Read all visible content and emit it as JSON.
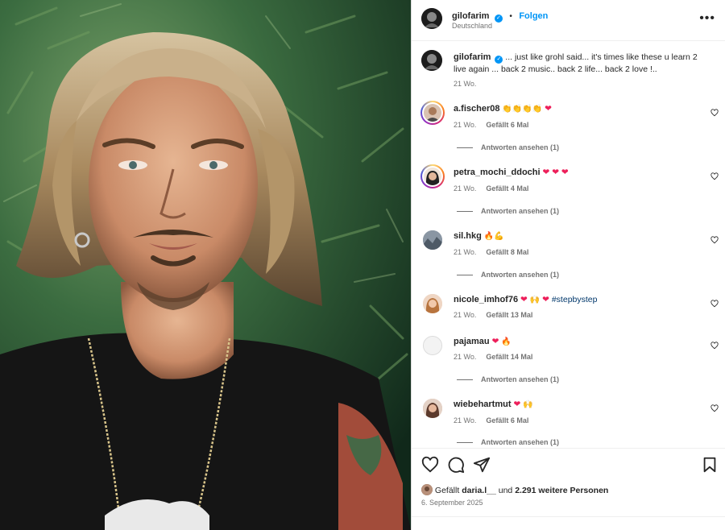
{
  "post": {
    "username": "gilofarim",
    "follow_label": "Folgen",
    "location": "Deutschland",
    "caption": "... just like grohl said... it's times like these u learn 2 live again ... back 2 music.. back 2 life... back 2 love !..",
    "caption_age": "21 Wo."
  },
  "comments": [
    {
      "user": "a.fischer08",
      "emoji": "👏👏👏👏",
      "heart": "❤",
      "age": "21 Wo.",
      "likes": "Gefällt 6 Mal",
      "replies": "Antworten ansehen (1)"
    },
    {
      "user": "petra_mochi_ddochi",
      "heart": "❤ ❤ ❤",
      "age": "21 Wo.",
      "likes": "Gefällt 4 Mal",
      "replies": "Antworten ansehen (1)"
    },
    {
      "user": "sil.hkg",
      "emoji": "🔥💪",
      "age": "21 Wo.",
      "likes": "Gefällt 8 Mal",
      "replies": "Antworten ansehen (1)"
    },
    {
      "user": "nicole_imhof76",
      "heart": "❤",
      "emoji": "🙌",
      "heart2": "❤",
      "hashtag": "#stepbystep",
      "age": "21 Wo.",
      "likes": "Gefällt 13 Mal"
    },
    {
      "user": "pajamau",
      "heart": "❤",
      "emoji": "🔥",
      "age": "21 Wo.",
      "likes": "Gefällt 14 Mal",
      "replies": "Antworten ansehen (1)"
    },
    {
      "user": "wiebehartmut",
      "heart": "❤",
      "emoji": "🙌",
      "age": "21 Wo.",
      "likes": "Gefällt 6 Mal",
      "replies": "Antworten ansehen (1)"
    }
  ],
  "footer": {
    "liked_prefix": "Gefällt",
    "liked_user": "daria.l__",
    "liked_mid": "und",
    "liked_count": "2.291 weitere Personen",
    "date": "6. September 2025"
  },
  "icons": {
    "verified": "verified-badge-icon",
    "more": "more-options-icon",
    "like": "heart-icon",
    "comment": "comment-icon",
    "share": "share-icon",
    "save": "bookmark-icon"
  },
  "colors": {
    "link": "#0095f6",
    "muted": "#737373",
    "text": "#262626",
    "heart": "#ed1f5a"
  }
}
